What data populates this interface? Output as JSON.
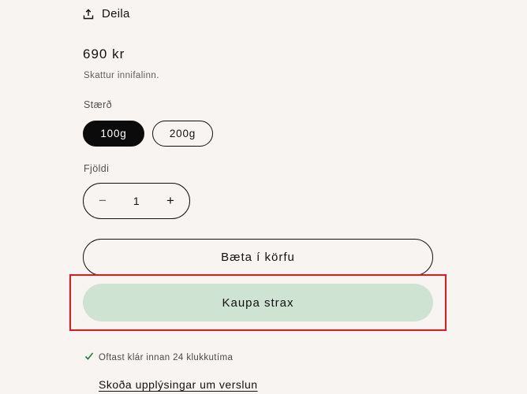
{
  "share": {
    "label": "Deila",
    "icon": "share-icon"
  },
  "price": {
    "amount": "690 kr",
    "tax_note": "Skattur innifalinn."
  },
  "size": {
    "label": "Stærð",
    "options": [
      "100g",
      "200g"
    ],
    "selected": "100g"
  },
  "quantity": {
    "label": "Fjöldi",
    "value": "1",
    "minus_symbol": "−",
    "plus_symbol": "+"
  },
  "actions": {
    "add_to_cart": "Bæta í körfu",
    "buy_now": "Kaupa strax"
  },
  "pickup": {
    "status": "Oftast klár innan 24 klukkutíma",
    "store_link": "Skoða upplýsingar um verslun"
  },
  "colors": {
    "background": "#f8f4f1",
    "selected_pill": "#0b0b0b",
    "buy_now_bg": "#cfe3d2",
    "highlight": "#e8151b",
    "check": "#1f7a3f"
  }
}
